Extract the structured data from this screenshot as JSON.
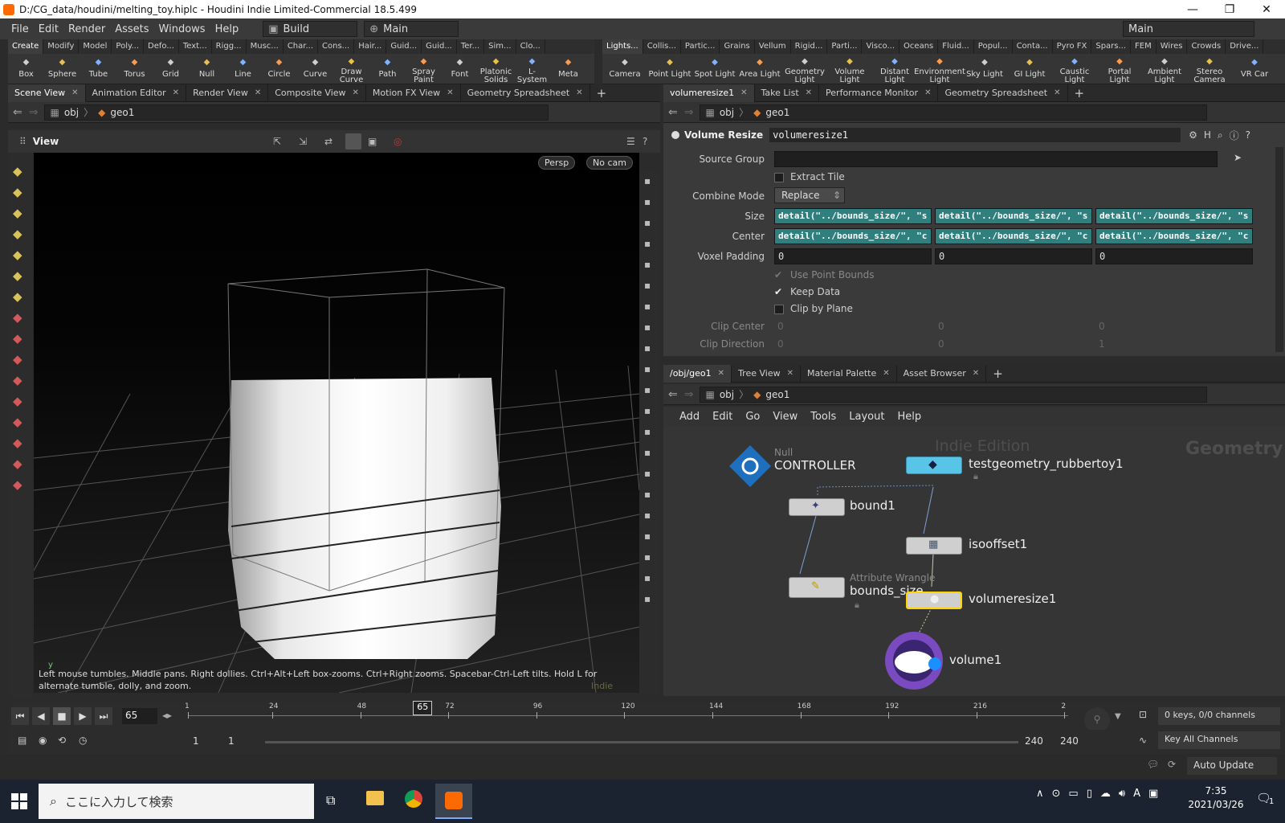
{
  "window": {
    "title": "D:/CG_data/houdini/melting_toy.hiplc - Houdini Indie Limited-Commercial 18.5.499"
  },
  "menu": {
    "items": [
      "File",
      "Edit",
      "Render",
      "Assets",
      "Windows",
      "Help"
    ],
    "desktop": "Build",
    "desktop2": "Main",
    "main_right": "Main"
  },
  "shelf_left": {
    "tabs": [
      "Create",
      "Modify",
      "Model",
      "Poly...",
      "Defo...",
      "Text...",
      "Rigg...",
      "Musc...",
      "Char...",
      "Cons...",
      "Hair...",
      "Guid...",
      "Guid...",
      "Ter...",
      "Sim...",
      "Clo..."
    ],
    "tools": [
      "Box",
      "Sphere",
      "Tube",
      "Torus",
      "Grid",
      "Null",
      "Line",
      "Circle",
      "Curve",
      "Draw Curve",
      "Path",
      "Spray Paint",
      "Font",
      "Platonic Solids",
      "L-System",
      "Meta"
    ]
  },
  "shelf_right": {
    "tabs": [
      "Lights...",
      "Collis...",
      "Partic...",
      "Grains",
      "Vellum",
      "Rigid...",
      "Parti...",
      "Visco...",
      "Oceans",
      "Fluid...",
      "Popul...",
      "Conta...",
      "Pyro FX",
      "Spars...",
      "FEM",
      "Wires",
      "Crowds",
      "Drive..."
    ],
    "tools": [
      "Camera",
      "Point Light",
      "Spot Light",
      "Area Light",
      "Geometry Light",
      "Volume Light",
      "Distant Light",
      "Environment Light",
      "Sky Light",
      "GI Light",
      "Caustic Light",
      "Portal Light",
      "Ambient Light",
      "Stereo Camera",
      "VR Car"
    ]
  },
  "left_tabs": [
    "Scene View",
    "Animation Editor",
    "Render View",
    "Composite View",
    "Motion FX View",
    "Geometry Spreadsheet"
  ],
  "left_path": {
    "a": "obj",
    "b": "geo1"
  },
  "viewport": {
    "title": "View",
    "persp": "Persp",
    "cam": "No cam",
    "hint": "Left mouse tumbles. Middle pans. Right dollies. Ctrl+Alt+Left box-zooms. Ctrl+Right zooms. Spacebar-Ctrl-Left tilts. Hold L for alternate tumble, dolly, and zoom.",
    "watermark": "Indie Edition",
    "axis": "y"
  },
  "right_tabs": [
    "volumeresize1",
    "Take List",
    "Performance Monitor",
    "Geometry Spreadsheet"
  ],
  "right_path": {
    "a": "obj",
    "b": "geo1"
  },
  "params": {
    "node_type": "Volume Resize",
    "node_name": "volumeresize1",
    "source_group_label": "Source Group",
    "extract_tile": "Extract Tile",
    "combine_mode_label": "Combine Mode",
    "combine_mode": "Replace",
    "size_label": "Size",
    "size_values": [
      "detail(\"../bounds_size/\", \"s",
      "detail(\"../bounds_size/\", \"s",
      "detail(\"../bounds_size/\", \"s"
    ],
    "center_label": "Center",
    "center_values": [
      "detail(\"../bounds_size/\", \"c",
      "detail(\"../bounds_size/\", \"c",
      "detail(\"../bounds_size/\", \"c"
    ],
    "voxel_label": "Voxel Padding",
    "voxel_values": [
      "0",
      "0",
      "0"
    ],
    "use_point_bounds": "Use Point Bounds",
    "keep_data": "Keep Data",
    "clip_plane": "Clip by Plane",
    "clip_center_label": "Clip Center",
    "clip_center": [
      "0",
      "0",
      "0"
    ],
    "clip_dir_label": "Clip Direction",
    "clip_dir": [
      "0",
      "0",
      "1"
    ]
  },
  "net_tabs": [
    "/obj/geo1",
    "Tree View",
    "Material Palette",
    "Asset Browser"
  ],
  "net_path": {
    "a": "obj",
    "b": "geo1"
  },
  "net_menu": [
    "Add",
    "Edit",
    "Go",
    "View",
    "Tools",
    "Layout",
    "Help"
  ],
  "network": {
    "watermark": "Indie Edition",
    "context": "Geometry",
    "nodes": {
      "controller": {
        "type": "Null",
        "name": "CONTROLLER"
      },
      "rubbertoy": {
        "name": "testgeometry_rubbertoy1"
      },
      "bound": {
        "name": "bound1"
      },
      "isooffset": {
        "name": "isooffset1"
      },
      "bounds_size": {
        "type": "Attribute Wrangle",
        "name": "bounds_size"
      },
      "volumeresize": {
        "name": "volumeresize1"
      },
      "volume": {
        "name": "volume1"
      }
    }
  },
  "timeline": {
    "frame": "65",
    "marker": "65",
    "ticks": [
      "1",
      "24",
      "48",
      "72",
      "96",
      "120",
      "144",
      "168",
      "192",
      "216",
      "2"
    ],
    "keys": "0 keys, 0/0 channels",
    "key_all": "Key All Channels"
  },
  "range": {
    "start1": "1",
    "start2": "1",
    "end1": "240",
    "end2": "240"
  },
  "status": {
    "auto_update": "Auto Update"
  },
  "taskbar": {
    "search_placeholder": "ここに入力して検索",
    "time": "7:35",
    "date": "2021/03/26",
    "ime": "A",
    "notif": "1"
  },
  "colors": {
    "accent_teal": "#2f7f7f",
    "selected_node": "#ffd400",
    "houdini_orange": "#ff6a00"
  }
}
